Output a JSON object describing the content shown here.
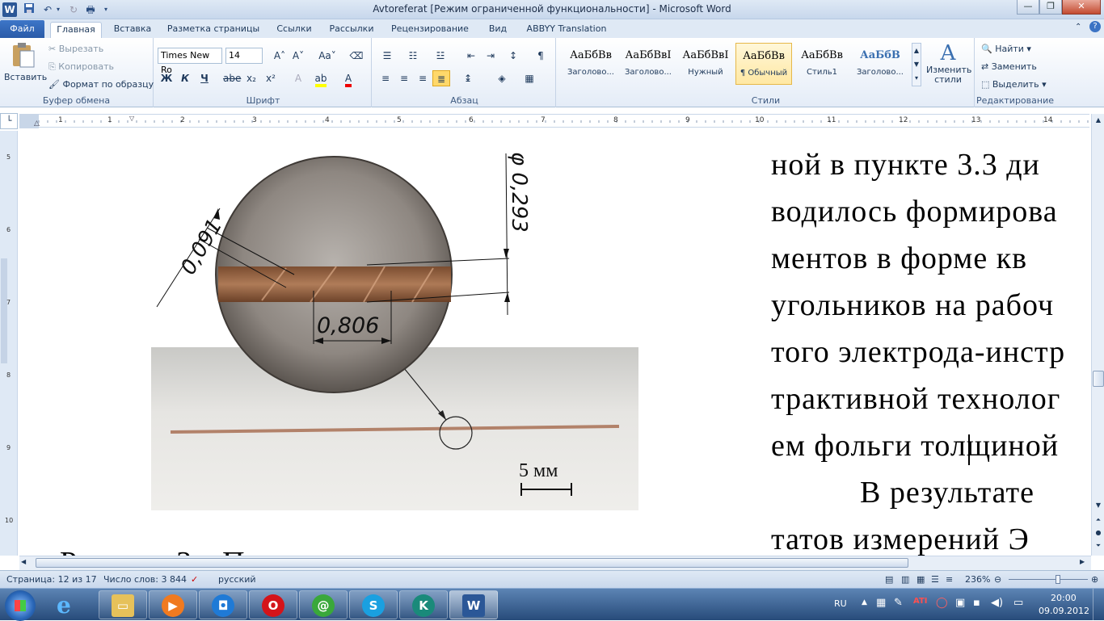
{
  "window": {
    "title": "Avtoreferat [Режим ограниченной функциональности] - Microsoft Word"
  },
  "ribbon_tabs": [
    "Файл",
    "Главная",
    "Вставка",
    "Разметка страницы",
    "Ссылки",
    "Рассылки",
    "Рецензирование",
    "Вид",
    "ABBYY Translation"
  ],
  "clipboard": {
    "paste": "Вставить",
    "cut": "Вырезать",
    "copy": "Копировать",
    "format_painter": "Формат по образцу",
    "group": "Буфер обмена"
  },
  "font": {
    "name": "Times New Ro",
    "size": "14",
    "group": "Шрифт",
    "bold": "Ж",
    "italic": "К",
    "underline": "Ч",
    "strike": "abe",
    "sub": "x₂",
    "sup": "x²",
    "grow": "A˄",
    "shrink": "A˅",
    "case": "Aa˅"
  },
  "paragraph": {
    "group": "Абзац",
    "pilcrow": "¶"
  },
  "styles": {
    "group": "Стили",
    "items": [
      {
        "sample": "АаБбВв",
        "name": "Заголово..."
      },
      {
        "sample": "АаБбВвI",
        "name": "Заголово..."
      },
      {
        "sample": "АаБбВвI",
        "name": "Нужный"
      },
      {
        "sample": "АаБбВв",
        "name": "¶ Обычный"
      },
      {
        "sample": "АаБбВв",
        "name": "Стиль1"
      },
      {
        "sample": "АаБбВ",
        "name": "Заголово..."
      }
    ],
    "change_styles": "Изменить стили"
  },
  "editing": {
    "group": "Редактирование",
    "find": "Найти",
    "replace": "Заменить",
    "select": "Выделить"
  },
  "ruler": {
    "h_numbers": [
      "1",
      "1",
      "2",
      "3",
      "4",
      "5",
      "6",
      "7",
      "8",
      "9",
      "10",
      "11",
      "12",
      "13",
      "14"
    ],
    "v_numbers": [
      "5",
      "6",
      "7",
      "8",
      "9",
      "10"
    ]
  },
  "figure": {
    "dim_thickness": "0,091",
    "dim_diameter": "φ 0,293",
    "dim_pitch": "0,806",
    "scale_label": "5 мм"
  },
  "document": {
    "lines": [
      "ной   в пункте 3.3 ди",
      "водилось   формирова",
      "ментов  в  форме  кв",
      "угольников  на  рабоч",
      "того  электрода-инстр",
      "трактивной  технолог",
      "ем фольги толщиной",
      "В   результате",
      "татов   измерений   Э"
    ],
    "cut_caption": "Рисунок 3 – П"
  },
  "status": {
    "page": "Страница: 12 из 17",
    "words": "Число слов: 3 844",
    "language": "русский",
    "zoom": "236%"
  },
  "taskbar": {
    "lang": "RU",
    "time": "20:00",
    "date": "09.09.2012",
    "apps": [
      "internet-explorer",
      "file-explorer",
      "media-player",
      "network-app",
      "opera",
      "mail-agent",
      "skype",
      "kaspersky",
      "word"
    ]
  }
}
